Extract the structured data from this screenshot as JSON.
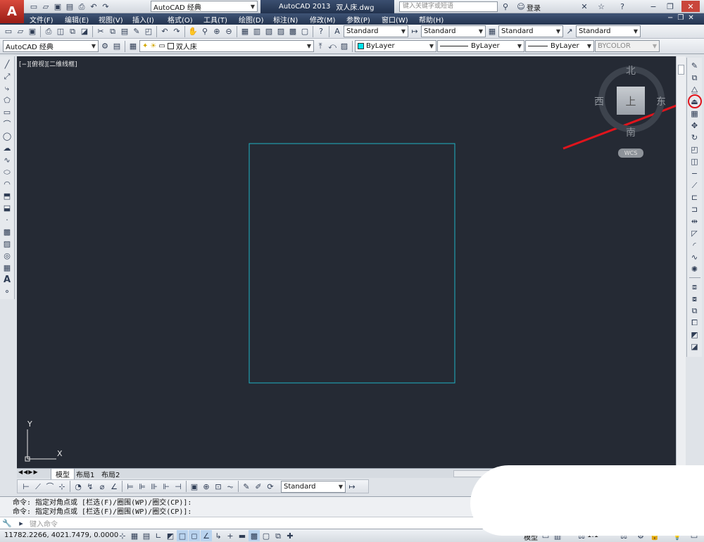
{
  "titlebar": {
    "workspace": "AutoCAD 经典",
    "app_name": "AutoCAD 2013",
    "file_name": "双人床.dwg",
    "search_placeholder": "键入关键字或短语",
    "login": "登录"
  },
  "menu": [
    "文件(F)",
    "编辑(E)",
    "视图(V)",
    "插入(I)",
    "格式(O)",
    "工具(T)",
    "绘图(D)",
    "标注(N)",
    "修改(M)",
    "参数(P)",
    "窗口(W)",
    "帮助(H)"
  ],
  "styles": {
    "text_style": "Standard",
    "dim_style": "Standard",
    "table_style": "Standard",
    "mleader_style": "Standard"
  },
  "layers": {
    "workspace": "AutoCAD 经典",
    "current_layer": "双人床",
    "color": "ByLayer",
    "linetype": "ByLayer",
    "lineweight": "ByLayer",
    "plotstyle": "BYCOLOR"
  },
  "viewport_label": "[−][俯视][二维线框]",
  "viewcube": {
    "north": "北",
    "south": "南",
    "east": "东",
    "west": "西",
    "face": "上",
    "wcs": "WCS"
  },
  "ucs": {
    "y": "Y",
    "x": "X"
  },
  "tabs": [
    "模型",
    "布局1",
    "布局2"
  ],
  "dim_style_combo": "Standard",
  "command_history": [
    "命令: 指定对角点或 [栏选(F)/圈围(WP)/圈交(CP)]:",
    "命令: 指定对角点或 [栏选(F)/圈围(WP)/圈交(CP)]:"
  ],
  "command_placeholder": "键入命令",
  "status": {
    "coords": "11782.2266, 4021.7479, 0.0000",
    "model": "模型",
    "scale": "1:1"
  },
  "colors": {
    "canvas": "#252a34",
    "rectangle": "#1fb3c4",
    "annotation": "#e0141c"
  }
}
